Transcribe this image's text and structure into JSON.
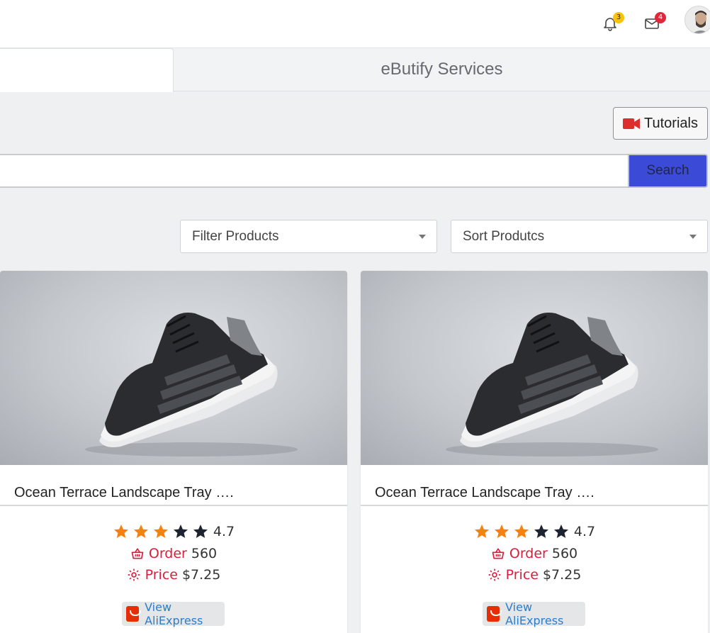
{
  "header": {
    "notifications_count": "3",
    "messages_count": "4",
    "icons": [
      "bell-icon",
      "mail-icon",
      "avatar"
    ]
  },
  "tabs": [
    {
      "label": ""
    },
    {
      "label": "eButify Services"
    }
  ],
  "toolbar": {
    "tutorials_label": "Tutorials",
    "tutorials_icon": "video-camera-icon",
    "tutorials_icon_color": "#dc2e2e"
  },
  "search": {
    "value": "",
    "placeholder": "",
    "button_label": "Search",
    "button_color": "#3b4bd8"
  },
  "filters": {
    "filter_label": "Filter Products",
    "sort_label": "Sort Produtcs"
  },
  "products": [
    {
      "title": "Ocean Terrace Landscape Tray ….",
      "rating": "4.7",
      "stars_filled": 3,
      "stars_total": 5,
      "order_label": "Order",
      "order_value": "560",
      "price_label": "Price",
      "price_value": "$7.25",
      "link_label": "View AliExpress"
    },
    {
      "title": "Ocean Terrace Landscape Tray ….",
      "rating": "4.7",
      "stars_filled": 3,
      "stars_total": 5,
      "order_label": "Order",
      "order_value": "560",
      "price_label": "Price",
      "price_value": "$7.25",
      "link_label": "View AliExpress"
    }
  ],
  "colors": {
    "star_filled": "#f5820f",
    "star_empty": "#1d2430",
    "accent_red": "#dc1e3c",
    "link_blue": "#2d7ec9"
  }
}
